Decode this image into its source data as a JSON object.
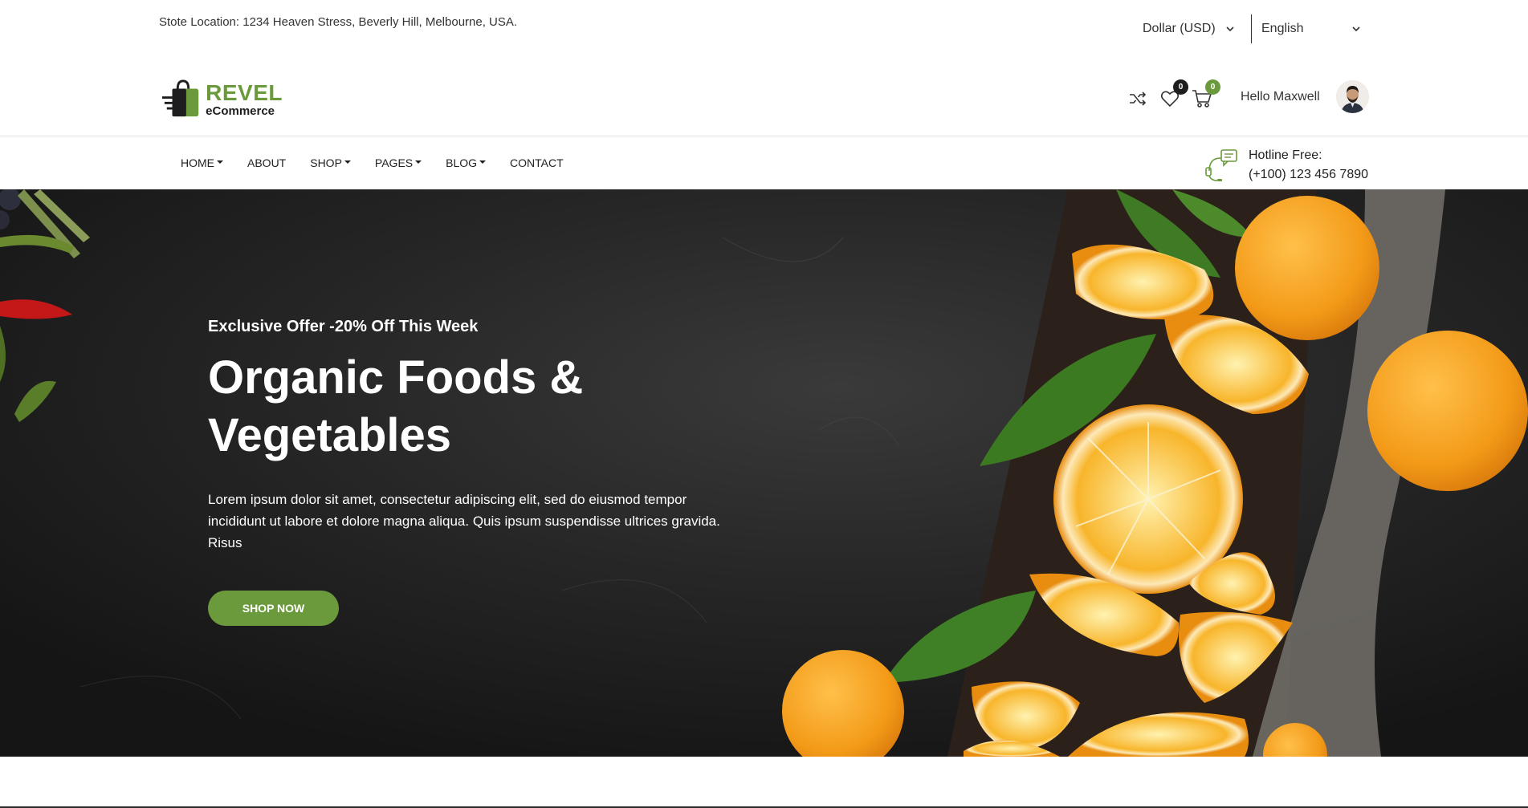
{
  "topbar": {
    "store_location": "Stote Location: 1234 Heaven Stress, Beverly Hill, Melbourne, USA.",
    "currency": "Dollar (USD)",
    "language": "English"
  },
  "header": {
    "logo": {
      "brand": "REVEL",
      "tagline": "eCommerce"
    },
    "wishlist_count": "0",
    "cart_count": "0",
    "greeting": "Hello Maxwell"
  },
  "nav": {
    "items": [
      {
        "label": "HOME",
        "dropdown": true
      },
      {
        "label": "ABOUT",
        "dropdown": false
      },
      {
        "label": "SHOP",
        "dropdown": true
      },
      {
        "label": "PAGES",
        "dropdown": true
      },
      {
        "label": "BLOG",
        "dropdown": true
      },
      {
        "label": "CONTACT",
        "dropdown": false
      }
    ],
    "hotline_label": "Hotline Free:",
    "hotline_number": "(+100) 123 456 7890"
  },
  "hero": {
    "offer": "Exclusive Offer -20% Off This Week",
    "title_line1": "Organic Foods &",
    "title_line2": "Vegetables",
    "description": "Lorem ipsum dolor sit amet, consectetur adipiscing elit, sed do eiusmod tempor incididunt ut labore et dolore magna aliqua. Quis ipsum suspendisse ultrices gravida. Risus",
    "cta": "SHOP NOW"
  },
  "colors": {
    "accent": "#6a9a3b",
    "badge_dark": "#1e1e1e",
    "hero_bg": "#1d1d1d",
    "orange": "#f4a31f"
  }
}
